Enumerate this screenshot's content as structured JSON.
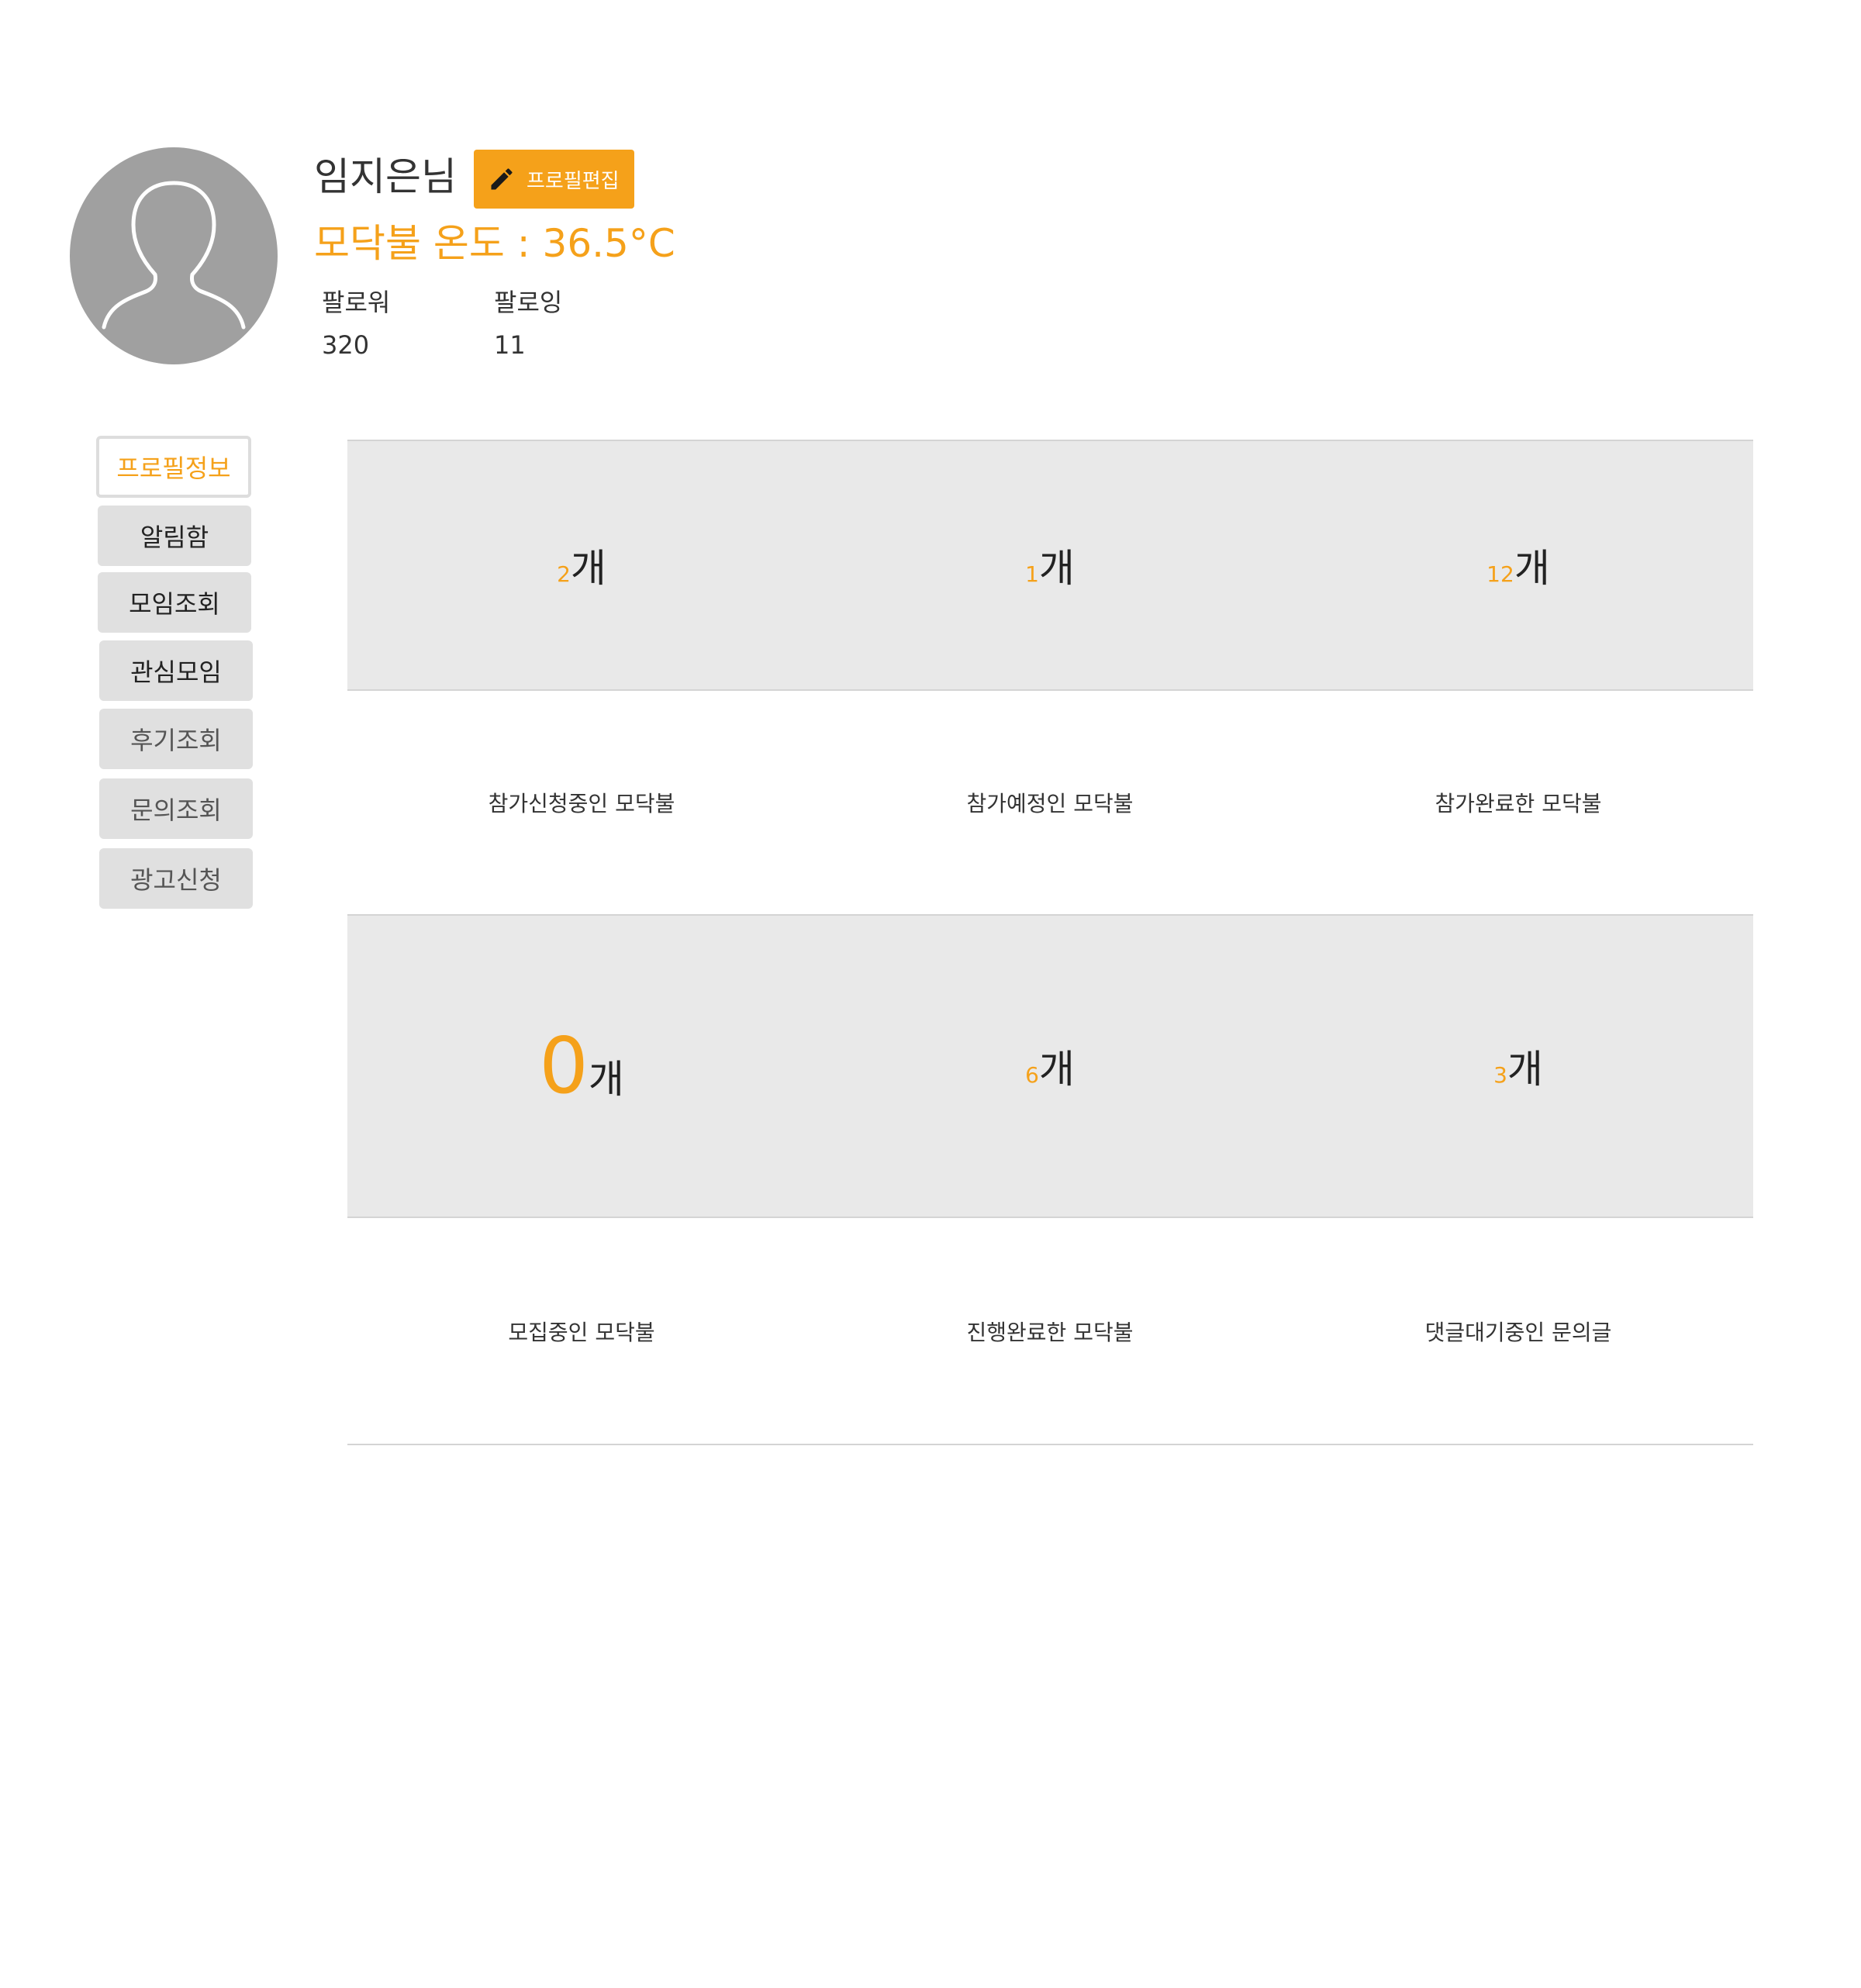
{
  "profile": {
    "user_name": "임지은님",
    "edit_label": "프로필편집",
    "temperature": "모닥불 온도 : 36.5°C",
    "followers_label": "팔로워",
    "followers_count": "320",
    "following_label": "팔로잉",
    "following_count": "11"
  },
  "side_menu": {
    "items": [
      {
        "label": "프로필정보"
      },
      {
        "label": "알림함"
      },
      {
        "label": "모임조회"
      },
      {
        "label": "관심모임"
      },
      {
        "label": "후기조회"
      },
      {
        "label": "문의조회"
      },
      {
        "label": "광고신청"
      }
    ]
  },
  "stats": {
    "unit": "개",
    "row1": [
      {
        "count": "2",
        "label": "참가신청중인 모닥불"
      },
      {
        "count": "1",
        "label": "참가예정인 모닥불"
      },
      {
        "count": "12",
        "label": "참가완료한 모닥불"
      }
    ],
    "row2": [
      {
        "count": "0",
        "label": "모집중인 모닥불"
      },
      {
        "count": "6",
        "label": "진행완료한 모닥불"
      },
      {
        "count": "3",
        "label": "댓글대기중인 문의글"
      }
    ]
  },
  "colors": {
    "accent": "#f5a11a",
    "panel_gray": "#e9e9e9",
    "avatar_gray": "#a0a0a0"
  }
}
